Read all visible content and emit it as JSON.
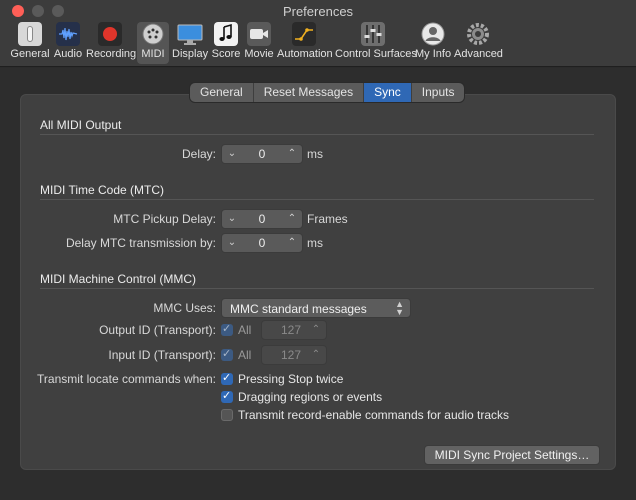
{
  "window": {
    "title": "Preferences"
  },
  "toolbar": {
    "items": [
      {
        "label": "General",
        "icon": "general-switch-icon"
      },
      {
        "label": "Audio",
        "icon": "audio-waveform-icon"
      },
      {
        "label": "Recording",
        "icon": "record-button-icon"
      },
      {
        "label": "MIDI",
        "icon": "midi-plug-icon"
      },
      {
        "label": "Display",
        "icon": "display-monitor-icon"
      },
      {
        "label": "Score",
        "icon": "music-note-icon"
      },
      {
        "label": "Movie",
        "icon": "movie-camera-icon"
      },
      {
        "label": "Automation",
        "icon": "automation-curve-icon"
      },
      {
        "label": "Control Surfaces",
        "icon": "faders-icon"
      },
      {
        "label": "My Info",
        "icon": "user-silhouette-icon"
      },
      {
        "label": "Advanced",
        "icon": "gear-icon"
      }
    ],
    "selected": "MIDI"
  },
  "tabs": {
    "items": [
      "General",
      "Reset Messages",
      "Sync",
      "Inputs"
    ],
    "active": "Sync"
  },
  "all_midi_output": {
    "title": "All MIDI Output",
    "delay_label": "Delay:",
    "delay_value": "0",
    "delay_unit": "ms"
  },
  "mtc": {
    "title": "MIDI Time Code (MTC)",
    "pickup_label": "MTC Pickup Delay:",
    "pickup_value": "0",
    "pickup_unit": "Frames",
    "transmission_label": "Delay MTC transmission by:",
    "transmission_value": "0",
    "transmission_unit": "ms"
  },
  "mmc": {
    "title": "MIDI Machine Control (MMC)",
    "uses_label": "MMC Uses:",
    "uses_value": "MMC standard messages",
    "output_label": "Output ID (Transport):",
    "output_all_label": "All",
    "output_value": "127",
    "input_label": "Input ID (Transport):",
    "input_all_label": "All",
    "input_value": "127",
    "transmit_label": "Transmit locate commands when:",
    "options": [
      {
        "label": "Pressing Stop twice",
        "checked": true
      },
      {
        "label": "Dragging regions or events",
        "checked": true
      },
      {
        "label": "Transmit record-enable commands for audio tracks",
        "checked": false
      }
    ]
  },
  "footer": {
    "button_label": "MIDI Sync Project Settings…"
  },
  "colors": {
    "accent": "#2f68b5",
    "close": "#ff5f57"
  }
}
